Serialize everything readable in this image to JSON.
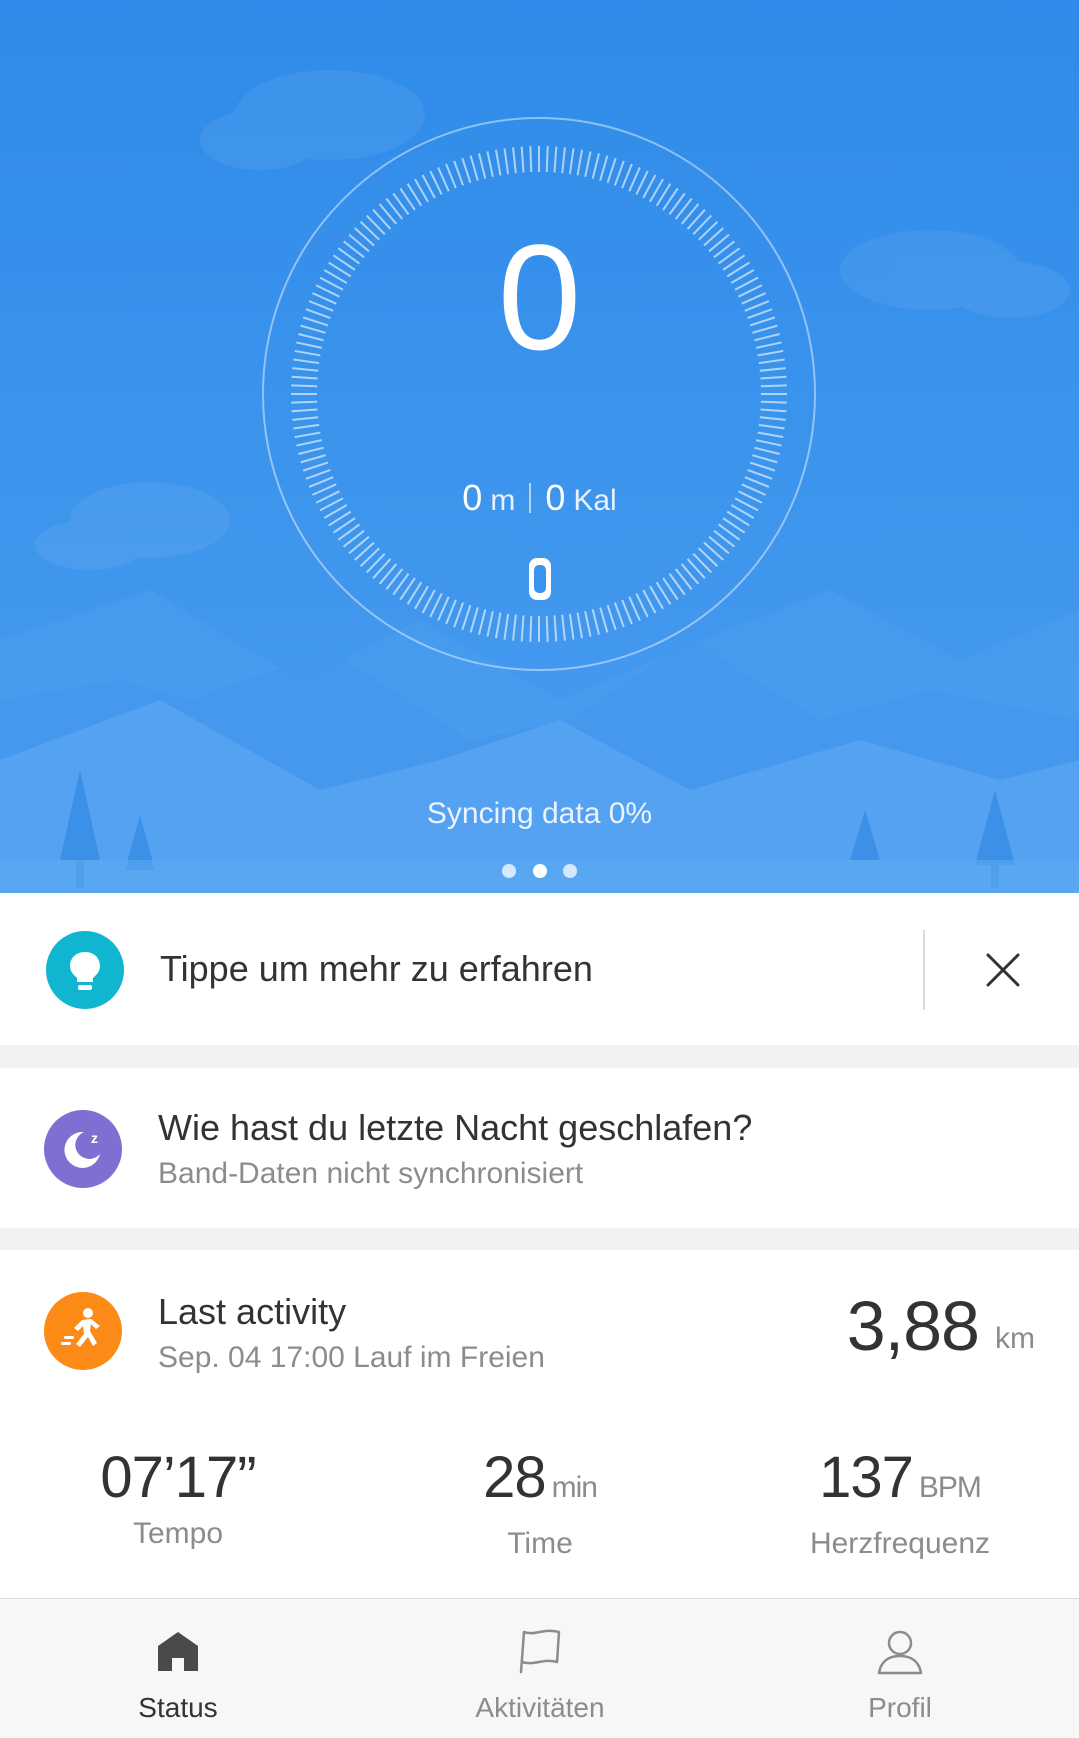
{
  "hero": {
    "steps": "0",
    "distance_value": "0",
    "distance_unit": "m",
    "calories_value": "0",
    "calories_unit": "Kal",
    "sync_status": "Syncing data 0%",
    "page_dots": 3,
    "active_dot": 1,
    "background_color": "#3a93ec"
  },
  "tip_card": {
    "text": "Tippe um mehr zu erfahren",
    "icon": "lightbulb-icon",
    "icon_color": "#10b6cf"
  },
  "sleep_card": {
    "title": "Wie hast du letzte Nacht geschlafen?",
    "subtitle": "Band-Daten nicht synchronisiert",
    "icon": "moon-sleep-icon",
    "icon_color": "#7e6fd2"
  },
  "activity_card": {
    "title": "Last activity",
    "subtitle": "Sep. 04 17:00 Lauf im Freien",
    "distance": "3,88",
    "distance_unit": "km",
    "icon": "running-icon",
    "icon_color": "#fb8a16",
    "stats": [
      {
        "value": "07’17”",
        "unit": "",
        "label": "Tempo"
      },
      {
        "value": "28",
        "unit": "min",
        "label": "Time"
      },
      {
        "value": "137",
        "unit": "BPM",
        "label": "Herzfrequenz"
      }
    ]
  },
  "nav": {
    "items": [
      {
        "label": "Status",
        "icon": "home-icon",
        "active": true
      },
      {
        "label": "Aktivitäten",
        "icon": "flag-icon",
        "active": false
      },
      {
        "label": "Profil",
        "icon": "person-icon",
        "active": false
      }
    ]
  }
}
